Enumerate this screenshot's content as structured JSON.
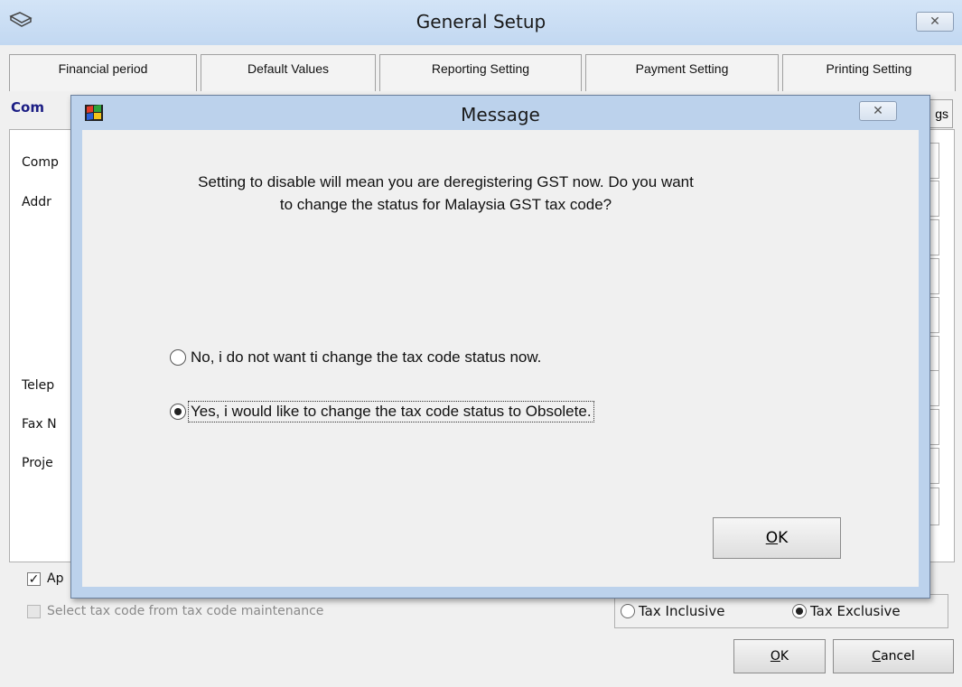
{
  "window": {
    "title": "General Setup",
    "close_glyph": "✕",
    "tabs": [
      "Financial period",
      "Default Values",
      "Reporting Setting",
      "Payment Setting",
      "Printing Setting"
    ],
    "subtab_left": "Com",
    "subtab_right": "gs"
  },
  "form": {
    "labels": [
      "Comp",
      "Addr",
      "Telep",
      "Fax N",
      "Proje"
    ]
  },
  "bottom": {
    "apply_label": "Ap",
    "apply_checked": true,
    "select_tax_label": "Select tax code from tax code maintenance",
    "tax_inclusive": "Tax Inclusive",
    "tax_exclusive": "Tax Exclusive",
    "tax_selected": "exclusive",
    "ok": {
      "mnemonic": "O",
      "rest": "K"
    },
    "cancel": {
      "mnemonic": "C",
      "rest": "ancel"
    }
  },
  "dialog": {
    "title": "Message",
    "close_glyph": "✕",
    "message_line1": "Setting to disable will mean you are deregistering GST now. Do you want",
    "message_line2": "to change the status for Malaysia GST tax code?",
    "options": [
      {
        "label": "No, i do not want ti change the tax code status now.",
        "selected": false
      },
      {
        "label": "Yes, i would like to change the tax code status to Obsolete.",
        "selected": true
      }
    ],
    "ok": {
      "mnemonic": "O",
      "rest": "K"
    }
  },
  "icons": {
    "app": "book-icon",
    "dialog": "windows-flag-icon",
    "close": "close-icon"
  },
  "colors": {
    "titlebar": "#c8dcf3",
    "dialog_frame": "#bcd2ec",
    "subtab_text": "#1b1d84"
  }
}
